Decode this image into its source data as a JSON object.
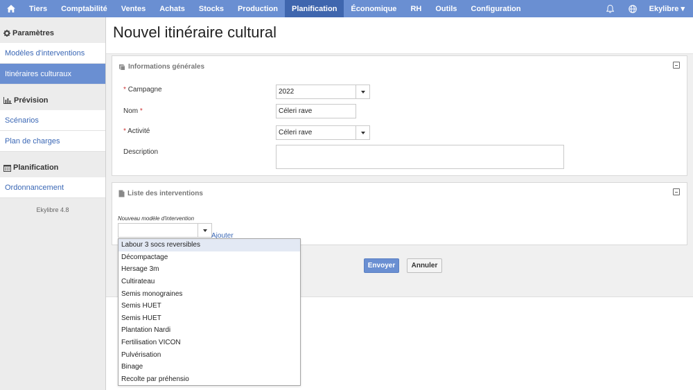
{
  "nav": {
    "items": [
      "Tiers",
      "Comptabilité",
      "Ventes",
      "Achats",
      "Stocks",
      "Production",
      "Planification",
      "Économique",
      "RH",
      "Outils",
      "Configuration"
    ],
    "active": "Planification",
    "user": "Ekylibre ▾"
  },
  "sidebar": {
    "sections": [
      {
        "title": "Paramètres",
        "icon": "gear-icon",
        "items": [
          "Modèles d'interventions",
          "Itinéraires culturaux"
        ]
      },
      {
        "title": "Prévision",
        "icon": "bar-chart-icon",
        "items": [
          "Scénarios",
          "Plan de charges"
        ]
      },
      {
        "title": "Planification",
        "icon": "calendar-icon",
        "items": [
          "Ordonnancement"
        ]
      }
    ],
    "active_item": "Itinéraires culturaux",
    "version": "Ekylibre 4.8"
  },
  "page": {
    "title": "Nouvel itinéraire cultural"
  },
  "general": {
    "title": "Informations générales",
    "campaign_label": "Campagne",
    "campaign_value": "2022",
    "name_label": "Nom",
    "name_value": "Céleri rave",
    "activity_label": "Activité",
    "activity_value": "Céleri rave",
    "description_label": "Description",
    "required_mark": "*"
  },
  "interventions": {
    "title": "Liste des interventions",
    "new_label": "Nouveau modèle d'intervention",
    "add_link": "Ajouter",
    "options": [
      "Labour 3 socs reversibles",
      "Décompactage",
      "Hersage 3m",
      "Cultirateau",
      "Semis monograines",
      "Semis HUET",
      "Semis HUET",
      "Plantation Nardi",
      "Fertilisation VICON",
      "Pulvérisation",
      "Binage",
      "Recolte par préhensio"
    ]
  },
  "actions": {
    "submit": "Envoyer",
    "cancel": "Annuler"
  },
  "colors": {
    "nav": "#6a8fd2",
    "nav_active": "#3f66ae",
    "link": "#3a67b5"
  }
}
